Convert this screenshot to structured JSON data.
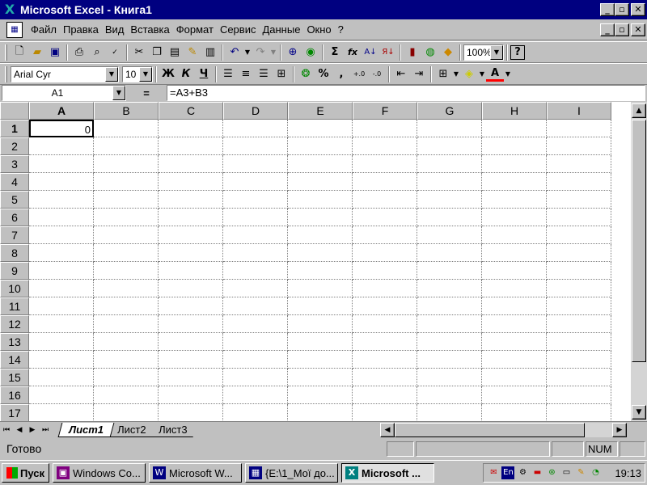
{
  "window": {
    "title": "Microsoft Excel - Книга1",
    "minimize": "_",
    "restore": "▫",
    "close": "✕"
  },
  "menu": {
    "items": [
      "Файл",
      "Правка",
      "Вид",
      "Вставка",
      "Формат",
      "Сервис",
      "Данные",
      "Окно",
      "?"
    ]
  },
  "standard_toolbar": {
    "zoom": "100%",
    "autosum": "Σ",
    "function": "fx",
    "help": "?"
  },
  "format_toolbar": {
    "font": "Arial Cyr",
    "size": "10",
    "bold": "Ж",
    "italic": "К",
    "underline": "Ч",
    "percent": "%",
    "comma": ","
  },
  "formula_bar": {
    "name_box": "A1",
    "equals": "=",
    "formula": "=A3+B3"
  },
  "sheet": {
    "columns": [
      "A",
      "B",
      "C",
      "D",
      "E",
      "F",
      "G",
      "H",
      "I"
    ],
    "rows": [
      "1",
      "2",
      "3",
      "4",
      "5",
      "6",
      "7",
      "8",
      "9",
      "10",
      "11",
      "12",
      "13",
      "14",
      "15",
      "16",
      "17"
    ],
    "active_cell": {
      "col": 0,
      "row": 0,
      "value": "0"
    }
  },
  "tabs": [
    "Лист1",
    "Лист2",
    "Лист3"
  ],
  "status": {
    "text": "Готово",
    "num": "NUM"
  },
  "taskbar": {
    "start": "Пуск",
    "tasks": [
      {
        "label": "Windows Co...",
        "icon": "disk-icon",
        "color": "#800080"
      },
      {
        "label": "Microsoft W...",
        "icon": "word-icon",
        "color": "#000080"
      },
      {
        "label": "{E:\\1_Мої до...",
        "icon": "folder-icon",
        "color": "#000080"
      },
      {
        "label": "Microsoft ...",
        "icon": "excel-icon",
        "color": "#008080"
      }
    ],
    "tray_lang": "En",
    "clock": "19:13"
  }
}
